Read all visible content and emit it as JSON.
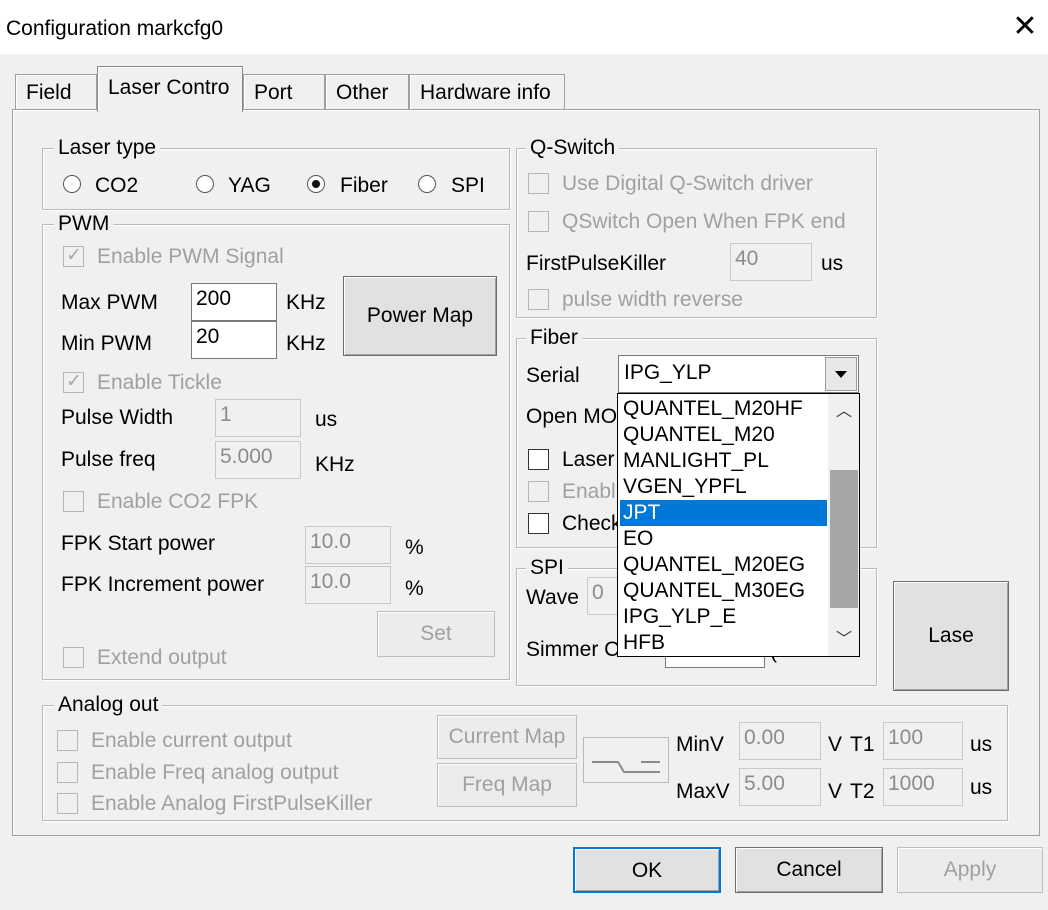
{
  "window": {
    "title": "Configuration markcfg0",
    "close_glyph": "✕"
  },
  "tabs": [
    {
      "label": "Field"
    },
    {
      "label": "Laser Contro"
    },
    {
      "label": "Port"
    },
    {
      "label": "Other"
    },
    {
      "label": "Hardware info"
    }
  ],
  "laser_type": {
    "title": "Laser type",
    "options": [
      "CO2",
      "YAG",
      "Fiber",
      "SPI"
    ],
    "selected": "Fiber"
  },
  "pwm": {
    "title": "PWM",
    "enable_pwm_label": "Enable PWM Signal",
    "max_pwm_label": "Max PWM",
    "max_pwm_value": "200",
    "max_pwm_unit": "KHz",
    "min_pwm_label": "Min PWM",
    "min_pwm_value": "20",
    "min_pwm_unit": "KHz",
    "power_map_button": "Power Map",
    "enable_tickle_label": "Enable Tickle",
    "pulse_width_label": "Pulse Width",
    "pulse_width_value": "1",
    "pulse_width_unit": "us",
    "pulse_freq_label": "Pulse freq",
    "pulse_freq_value": "5.000",
    "pulse_freq_unit": "KHz",
    "enable_co2_fpk_label": "Enable CO2 FPK",
    "fpk_start_label": "FPK Start power",
    "fpk_start_value": "10.0",
    "fpk_start_unit": "%",
    "fpk_inc_label": "FPK Increment power",
    "fpk_inc_value": "10.0",
    "fpk_inc_unit": "%",
    "set_button": "Set",
    "extend_output_label": "Extend output"
  },
  "qswitch": {
    "title": "Q-Switch",
    "digital_driver_label": "Use Digital Q-Switch driver",
    "open_fpk_label": "QSwitch Open When FPK end",
    "first_pulse_killer_label": "FirstPulseKiller",
    "first_pulse_killer_value": "40",
    "first_pulse_killer_unit": "us",
    "pulse_width_reverse_label": "pulse width reverse"
  },
  "fiber": {
    "title": "Fiber",
    "serial_label": "Serial",
    "serial_value": "IPG_YLP",
    "open_mo_label": "Open MO",
    "laser_label": "Laser",
    "enable_label": "Enabl",
    "check_label": "Check",
    "dropdown_items": [
      "QUANTEL_M20HF",
      "QUANTEL_M20",
      "MANLIGHT_PL",
      "VGEN_YPFL",
      "JPT",
      "EO",
      "QUANTEL_M20EG",
      "QUANTEL_M30EG",
      "IPG_YLP_E",
      "HFB"
    ],
    "dropdown_selected": "JPT"
  },
  "spi": {
    "title": "SPI",
    "wave_label": "Wave",
    "wave_value": "0",
    "simmer_label": "Simmer Cu",
    "simmer_unit_fragment": "(-"
  },
  "lase_button": "Lase",
  "analog_out": {
    "title": "Analog out",
    "enable_current_label": "Enable current output",
    "enable_freq_label": "Enable Freq analog output",
    "enable_fpk_label": "Enable Analog FirstPulseKiller",
    "current_map_button": "Current Map",
    "freq_map_button": "Freq Map",
    "minv_label": "MinV",
    "minv_value": "0.00",
    "minv_unit": "V",
    "maxv_label": "MaxV",
    "maxv_value": "5.00",
    "maxv_unit": "V",
    "t1_label": "T1",
    "t1_value": "100",
    "t1_unit": "us",
    "t2_label": "T2",
    "t2_value": "1000",
    "t2_unit": "us"
  },
  "footer": {
    "ok": "OK",
    "cancel": "Cancel",
    "apply": "Apply"
  }
}
